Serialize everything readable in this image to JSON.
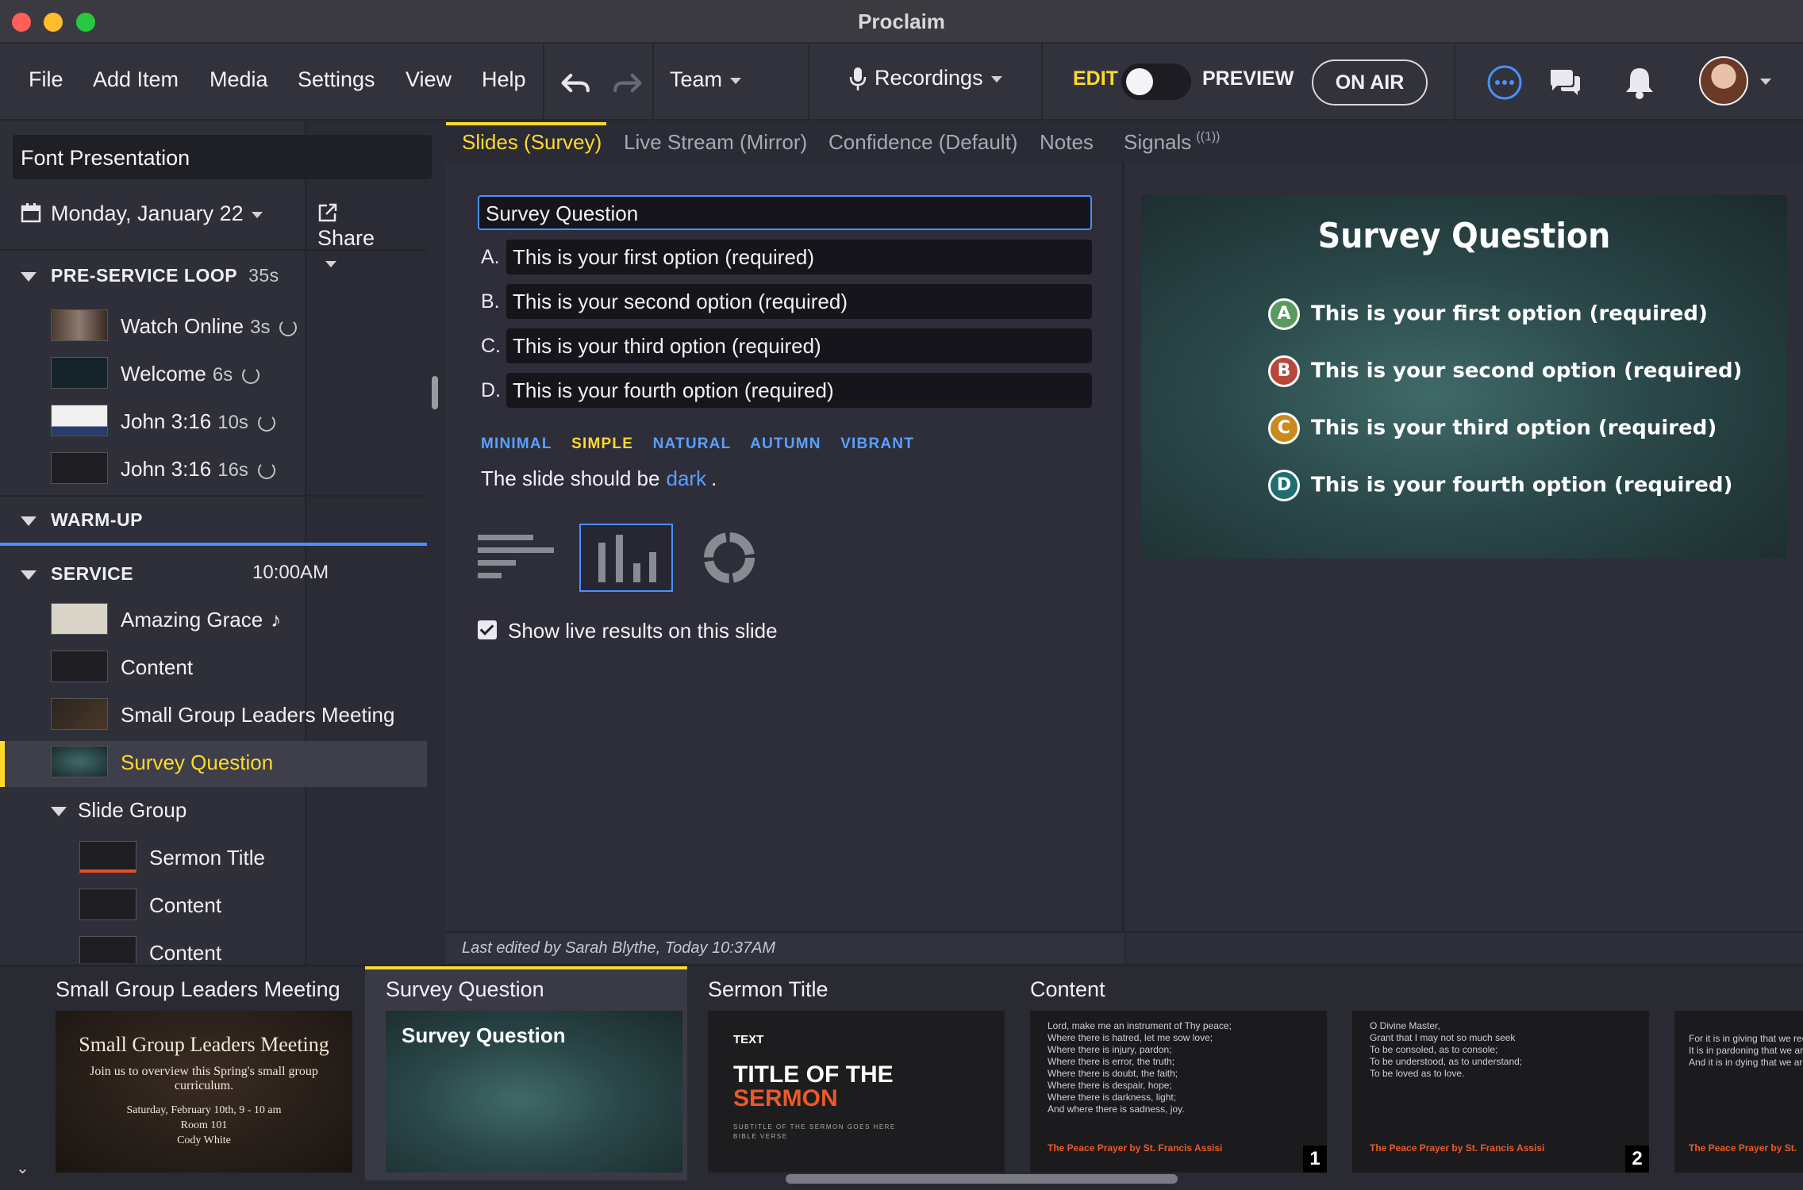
{
  "window": {
    "title": "Proclaim"
  },
  "menu": {
    "items": [
      "File",
      "Add Item",
      "Media",
      "Settings",
      "View",
      "Help"
    ],
    "team": "Team",
    "recordings": "Recordings",
    "edit": "EDIT",
    "preview": "PREVIEW",
    "on_air": "ON AIR"
  },
  "sidebar": {
    "presentation": "Font Presentation",
    "date": "Monday, January 22",
    "share": "Share",
    "sections": [
      {
        "name": "PRE-SERVICE LOOP",
        "meta": "35s"
      },
      {
        "name": "WARM-UP",
        "meta": ""
      },
      {
        "name": "SERVICE",
        "meta": "10:00AM"
      }
    ],
    "preservice": [
      {
        "label": "Watch Online",
        "dur": "3s"
      },
      {
        "label": "Welcome",
        "dur": "6s"
      },
      {
        "label": "John 3:16",
        "dur": "10s"
      },
      {
        "label": "John 3:16",
        "dur": "16s"
      }
    ],
    "service": [
      {
        "label": "Amazing Grace",
        "note": "♪"
      },
      {
        "label": "Content"
      },
      {
        "label": "Small Group Leaders Meeting"
      },
      {
        "label": "Survey Question"
      }
    ],
    "group": {
      "label": "Slide Group",
      "items": [
        "Sermon Title",
        "Content",
        "Content"
      ]
    }
  },
  "tabs": [
    {
      "label": "Slides (Survey)",
      "active": true
    },
    {
      "label": "Live Stream (Mirror)"
    },
    {
      "label": "Confidence (Default)"
    },
    {
      "label": "Notes"
    },
    {
      "label": "Signals",
      "badge": "((1))"
    }
  ],
  "editor": {
    "question": "Survey Question",
    "options": [
      {
        "letter": "A.",
        "text": "This is your first option (required)"
      },
      {
        "letter": "B.",
        "text": "This is your second option (required)"
      },
      {
        "letter": "C.",
        "text": "This is your third option (required)"
      },
      {
        "letter": "D.",
        "text": "This is your fourth option (required)"
      }
    ],
    "themes": [
      "MINIMAL",
      "SIMPLE",
      "NATURAL",
      "AUTUMN",
      "VIBRANT"
    ],
    "selected_theme": "SIMPLE",
    "dark_prefix": "The slide should be",
    "dark_value": "dark",
    "dark_suffix": ".",
    "show_results": "Show live results on this slide",
    "last_edited": "Last edited by Sarah Blythe, Today 10:37AM"
  },
  "preview": {
    "title": "Survey Question",
    "options": [
      {
        "badge": "A",
        "text": "This is your first option (required)",
        "color": "#5a9a5e"
      },
      {
        "badge": "B",
        "text": "This is your second option (required)",
        "color": "#b8473a"
      },
      {
        "badge": "C",
        "text": "This is your third option (required)",
        "color": "#c98b1e"
      },
      {
        "badge": "D",
        "text": "This is your fourth option (required)",
        "color": "#1f6f72"
      }
    ]
  },
  "filmstrip": {
    "items": [
      {
        "label": "Small Group Leaders Meeting"
      },
      {
        "label": "Survey Question"
      },
      {
        "label": "Sermon Title"
      },
      {
        "label": "Content"
      },
      {
        "label": ""
      },
      {
        "label": ""
      }
    ],
    "sglm": {
      "title": "Small Group Leaders Meeting",
      "body": "Join us to overview this Spring's small group curriculum.",
      "when": "Saturday, February 10th, 9 - 10 am",
      "where": "Room 101",
      "who": "Cody White"
    },
    "survey_thumb": "Survey Question",
    "sermon": {
      "small": "TEXT",
      "line1": "TITLE OF THE",
      "line2": "SERMON",
      "sub": "SUBTITLE OF THE SERMON GOES HERE",
      "verse": "BIBLE VERSE"
    },
    "content1": {
      "lines": [
        "Lord, make me an instrument of Thy peace;",
        "Where there is hatred, let me sow love;",
        "Where there is injury, pardon;",
        "Where there is error, the truth;",
        "Where there is doubt, the faith;",
        "Where there is despair, hope;",
        "Where there is darkness, light;",
        "And where there is sadness, joy."
      ],
      "footer": "The Peace Prayer by St. Francis Assisi",
      "num": "1"
    },
    "content2": {
      "lines": [
        "O Divine Master,",
        "Grant that I may not so much seek",
        "To be consoled, as to console;",
        "To be understood, as to understand;",
        "To be loved as to love."
      ],
      "footer": "The Peace Prayer by St. Francis Assisi",
      "num": "2"
    },
    "content3": {
      "lines": [
        "For it is in giving that we rec",
        "It is in pardoning that we are",
        "And it is in dying that we are"
      ],
      "footer": "The Peace Prayer by St."
    }
  }
}
